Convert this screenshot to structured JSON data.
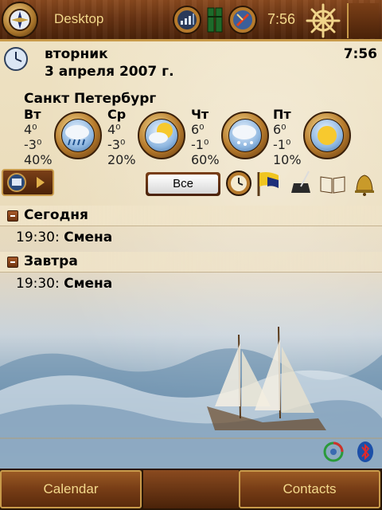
{
  "titlebar": {
    "app_title": "Desktop",
    "time": "7:56"
  },
  "date": {
    "weekday": "вторник",
    "full_date": "3 апреля 2007 г.",
    "time": "7:56"
  },
  "weather": {
    "city": "Санкт Петербург",
    "days": [
      {
        "name": "Вт",
        "high": "4⁰",
        "low": "-3⁰",
        "precip": "40%",
        "icon": "rain-cloud-icon"
      },
      {
        "name": "Ср",
        "high": "4⁰",
        "low": "-3⁰",
        "precip": "20%",
        "icon": "sun-cloud-icon"
      },
      {
        "name": "Чт",
        "high": "6⁰",
        "low": "-1⁰",
        "precip": "60%",
        "icon": "snow-cloud-icon"
      },
      {
        "name": "Пт",
        "high": "6⁰",
        "low": "-1⁰",
        "precip": "10%",
        "icon": "sunny-icon"
      }
    ]
  },
  "toolbar": {
    "filter_label": "Все"
  },
  "calendar": {
    "sections": [
      {
        "label": "Сегодня",
        "items": [
          {
            "time": "19:30:",
            "subject": "Смена"
          }
        ]
      },
      {
        "label": "Завтра",
        "items": [
          {
            "time": "19:30:",
            "subject": "Смена"
          }
        ]
      }
    ]
  },
  "softkeys": {
    "left": "Calendar",
    "right": "Contacts"
  },
  "colors": {
    "wood": "#6b3514",
    "brass": "#c89a4a",
    "title_text": "#f3d98c"
  }
}
